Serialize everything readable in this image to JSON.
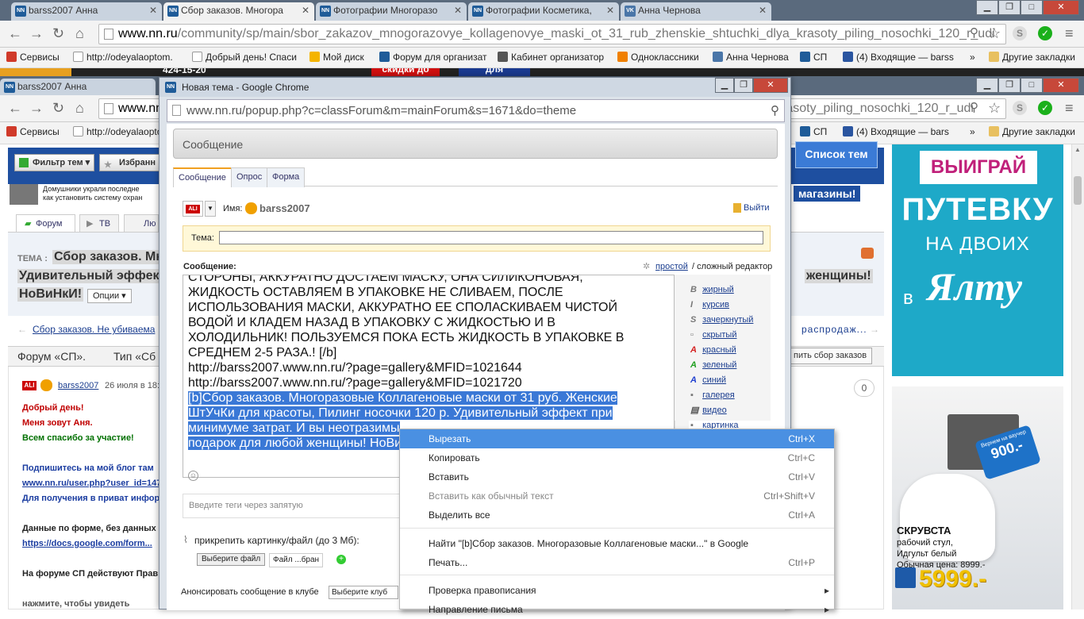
{
  "tabs": [
    {
      "label": "barss2007 Анна",
      "fav": "NN"
    },
    {
      "label": "Сбор заказов. Многора",
      "fav": "NN"
    },
    {
      "label": "Фотографии Многоразо",
      "fav": "NN"
    },
    {
      "label": "Фотографии Косметика,",
      "fav": "NN"
    },
    {
      "label": "Анна Чернова",
      "fav": "VK"
    }
  ],
  "address_bar": {
    "host": "www.nn.ru",
    "path": "/community/sp/main/sbor_zakazov_mnogorazovye_kollagenovye_maski_ot_31_rub_zhenskie_shtuchki_dlya_krasoty_piling_nosochki_120_r_udi"
  },
  "bookmarks": [
    "Сервисы",
    "http://odeyalaoptom.",
    "Добрый день! Спаси",
    "Мой диск",
    "Форум для организат",
    "Кабинет организатор",
    "Одноклассники",
    "Анна Чернова",
    "СП",
    "(4) Входящие — barss"
  ],
  "bookmarks_more": "»",
  "bookmarks_other": "Другие закладки",
  "bg_window": {
    "tab_label": "barss2007 Анна",
    "address_prefix": "www.nn.",
    "address_suffix": "rasoty_piling_nosochki_120_r_udi",
    "bookmarks": [
      "Сервисы",
      "http://odeyalaoptom.",
      "СП",
      "(4) Входящие — bars"
    ],
    "bookmarks_other": "Другие закладки"
  },
  "background_page": {
    "banner_strip": [
      "424-15-20",
      "скидки до",
      "для"
    ],
    "filter_btn": "Фильтр тем",
    "fav_btn": "Избранн",
    "list_btn": "Список тем",
    "shops": "магазины!",
    "news1": "Домушники украли последне",
    "news2": "как установить систему охран",
    "nav_forum": "Форум",
    "nav_tv": "ТВ",
    "nav_lyu": "Лю",
    "theme_label": "ТЕМА :",
    "theme_title_left": "Сбор заказов. Мн",
    "theme_line2_left": "Удивительный эффек",
    "theme_line2_right": "женщины!",
    "theme_line3": "НоВиНкИ!",
    "options": "Опции",
    "crumb": "Сбор заказов. Не убиваема",
    "crumb_right": "распродаж...",
    "forum_sp": "Форум «СП».",
    "type_label": "Тип «Сб",
    "collect_btn": "пить сбор заказов",
    "post_author": "barss2007",
    "post_date": "26 июля в 18:",
    "post_counter": "0",
    "post_lines": [
      {
        "text": "Добрый день!",
        "color": "#c00000"
      },
      {
        "text": "Меня зовут Аня.",
        "color": "#c00000"
      },
      {
        "text": "Всем спасибо за участие!",
        "color": "#007000"
      },
      {
        "text": "Подпишитесь на мой блог там",
        "color": "#1a3ca0"
      },
      {
        "text": "www.nn.ru/user.php?user_id=147",
        "color": "#1a3ca0"
      },
      {
        "text": "Для получения в приват инфор",
        "color": "#1a3ca0"
      },
      {
        "text": "Данные по форме, без данных",
        "color": "#222222"
      },
      {
        "text": "https://docs.google.com/form...",
        "color": "#1a3ca0"
      },
      {
        "text": "На форуме СП действуют Прав",
        "color": "#222222"
      },
      {
        "text": "нажмите, чтобы увидеть",
        "color": "#555555"
      }
    ],
    "ad1": {
      "top": "ВЫИГРАЙ",
      "big": "ПУТЕВКУ",
      "mid": "НА ДВОИХ",
      "v": "в",
      "city": "Ялту"
    },
    "ad2": {
      "badge_top": "Вернем на ваучер",
      "badge_price": "900.-",
      "name": "СКРУВСТА",
      "desc1": "рабочий стул,",
      "desc2": "Идгульт белый",
      "old": "Обычная цена: 8999.-",
      "price": "5999.-"
    }
  },
  "popup": {
    "title": "Новая тема - Google Chrome",
    "url": "www.nn.ru/popup.php?c=classForum&m=mainForum&s=1671&do=theme",
    "section_title": "Сообщение",
    "tabs": [
      "Сообщение",
      "Опрос",
      "Форма"
    ],
    "name_label": "Имя:",
    "username": "barss2007",
    "logout": "Выйти",
    "theme_label": "Тема:",
    "message_label": "Сообщение:",
    "editor_simple": "простой",
    "editor_complex": "/ сложный редактор",
    "text_lines": [
      "СТОРОНЫ, АККУРАТНО ДОСТАЕМ МАСКУ, ОНА СИЛИКОНОВАЯ,",
      "ЖИДКОСТЬ ОСТАВЛЯЕМ В УПАКОВКЕ НЕ СЛИВАЕМ, ПОСЛЕ",
      "ИСПОЛЬЗОВАНИЯ МАСКИ, АККУРАТНО ЕЕ СПОЛАСКИВАЕМ ЧИСТОЙ",
      "ВОДОЙ И КЛАДЕМ НАЗАД В УПАКОВКУ С ЖИДКОСТЬЮ И В",
      "ХОЛОДИЛЬНИК! ПОЛЬЗУЕМСЯ ПОКА ЕСТЬ ЖИДКОСТЬ В УПАКОВКЕ В",
      "СРЕДНЕМ 2-5 РАЗА.! [/b]",
      "http://barss2007.www.nn.ru/?page=gallery&MFID=1021644",
      "http://barss2007.www.nn.ru/?page=gallery&MFID=1021720"
    ],
    "selected_lines": [
      "[b]Сбор заказов. Многоразовые Коллагеновые маски от 31 руб. Женские",
      "ШтУчКи для красоты, Пилинг носочки 120 р. Удивительный эффект при",
      "минимуме затрат. И вы неотразимы",
      "подарок для любой женщины! НоВи"
    ],
    "format": [
      {
        "icon": "B",
        "label": "жирный",
        "color": "#777"
      },
      {
        "icon": "I",
        "label": "курсив",
        "color": "#777"
      },
      {
        "icon": "S",
        "label": "зачеркнутый",
        "color": "#777"
      },
      {
        "icon": "▫",
        "label": "скрытый",
        "color": "#777"
      },
      {
        "icon": "A",
        "label": "красный",
        "color": "#d42020"
      },
      {
        "icon": "A",
        "label": "зеленый",
        "color": "#20a020"
      },
      {
        "icon": "A",
        "label": "синий",
        "color": "#2040d0"
      },
      {
        "icon": "▪",
        "label": "галерея",
        "color": "#777"
      },
      {
        "icon": "▤",
        "label": "видео",
        "color": "#555"
      },
      {
        "icon": "▪",
        "label": "картинка",
        "color": "#777"
      }
    ],
    "tags_placeholder": "Введите теги через запятую",
    "attach_label": "прикрепить картинку/файл (до 3 Мб):",
    "choose_file": "Выберите файл",
    "file_none": "Файл ...бран",
    "announce_label": "Анонсировать сообщение в клубе",
    "club_select": "Выберите клуб"
  },
  "context_menu": {
    "items": [
      {
        "label": "Вырезать",
        "shortcut": "Ctrl+X",
        "state": "highlighted"
      },
      {
        "label": "Копировать",
        "shortcut": "Ctrl+C",
        "state": "normal"
      },
      {
        "label": "Вставить",
        "shortcut": "Ctrl+V",
        "state": "normal"
      },
      {
        "label": "Вставить как обычный текст",
        "shortcut": "Ctrl+Shift+V",
        "state": "disabled"
      },
      {
        "label": "Выделить все",
        "shortcut": "Ctrl+A",
        "state": "normal"
      },
      {
        "label": "Найти \"[b]Сбор заказов. Многоразовые Коллагеновые маски...\" в Google",
        "shortcut": "",
        "state": "normal"
      },
      {
        "label": "Печать...",
        "shortcut": "Ctrl+P",
        "state": "normal"
      },
      {
        "label": "Проверка правописания",
        "shortcut": "",
        "state": "submenu"
      },
      {
        "label": "Направление письма",
        "shortcut": "",
        "state": "submenu"
      }
    ]
  },
  "colors": {
    "selection": "#3a78d6",
    "menu_highlight": "#4a90e2",
    "link": "#1a3d8f",
    "ad_blue": "#1ea9c8"
  }
}
